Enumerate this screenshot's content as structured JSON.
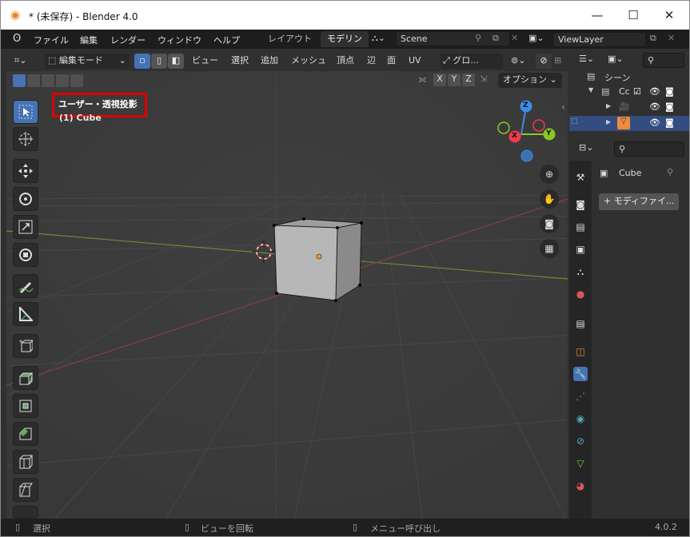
{
  "titlebar": {
    "title": "* (未保存) - Blender 4.0",
    "minimize": "—",
    "maximize": "☐",
    "close": "✕"
  },
  "menubar": {
    "menus": [
      "ファイル",
      "編集",
      "レンダー",
      "ウィンドウ",
      "ヘルプ"
    ],
    "tabs": [
      "レイアウト",
      "モデリン"
    ],
    "scene": "Scene",
    "view_layer": "ViewLayer"
  },
  "viewport_header": {
    "mode": "編集モード",
    "menus": [
      "ビュー",
      "選択",
      "追加",
      "メッシュ",
      "頂点",
      "辺",
      "面",
      "UV"
    ],
    "transform_orientation": "グロ...",
    "axes": [
      "X",
      "Y",
      "Z"
    ],
    "options": "オプション"
  },
  "viewport": {
    "view_label": "ユーザー・透視投影",
    "object_label": "(1) Cube",
    "gizmo": {
      "z": "Z",
      "x": "X",
      "y": "Y"
    }
  },
  "outliner": {
    "scene_collection": "シーン",
    "collection": "Cc"
  },
  "properties": {
    "object_name": "Cube",
    "add_modifier": "+ モディファイ..."
  },
  "statusbar": {
    "select": "選択",
    "rotate_view": "ビューを回転",
    "call_menu": "メニュー呼び出し",
    "version": "4.0.2"
  },
  "colors": {
    "accent": "#4772b3",
    "highlight_box": "#e00000",
    "x_axis": "#f03a4e",
    "y_axis": "#8cc821",
    "z_axis": "#3b8ce8"
  }
}
